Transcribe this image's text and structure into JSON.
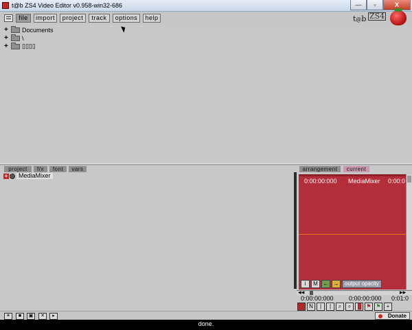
{
  "window": {
    "title": "t@b ZS4 Video Editor v0.958-win32-686",
    "controls": [
      "—",
      "▫",
      "X"
    ]
  },
  "menu": {
    "items": [
      "file",
      "import",
      "project",
      "track",
      "options",
      "help"
    ],
    "active": "file"
  },
  "logo": {
    "t": "t",
    "at": "@",
    "b": "b",
    "zs": "ZS4"
  },
  "browser": {
    "tree": [
      {
        "label": "Documents"
      },
      {
        "label": "\\"
      },
      {
        "label": "▯▯▯▯"
      }
    ]
  },
  "left_panel": {
    "tabs": [
      "project",
      "f/x",
      "font",
      "vars"
    ],
    "items": [
      {
        "label": "MediaMixer"
      }
    ]
  },
  "right_panel": {
    "tabs": [
      "arrangement",
      "current"
    ],
    "active_tab": "current",
    "header": {
      "start_time": "0:00:00:000",
      "name": "MediaMixer",
      "end_time": "0:00:0"
    },
    "prop_buttons": [
      "i",
      "M",
      "←",
      "→"
    ],
    "output_label": "output opacity",
    "times": {
      "t1": "0:00:00:000",
      "t2": "0:00:00:000",
      "t3": "0:01:0"
    },
    "colors": {
      "track_area": "#b22e3a",
      "opacity_line": "#f07020",
      "current_tab": "#c89ab0"
    }
  },
  "bottom": {
    "tool_icons": [
      "bulb-icon",
      "save-icon",
      "export-icon",
      "tools-icon",
      "play-icon"
    ],
    "donate_label": "Donate"
  },
  "status": {
    "text": "done."
  }
}
